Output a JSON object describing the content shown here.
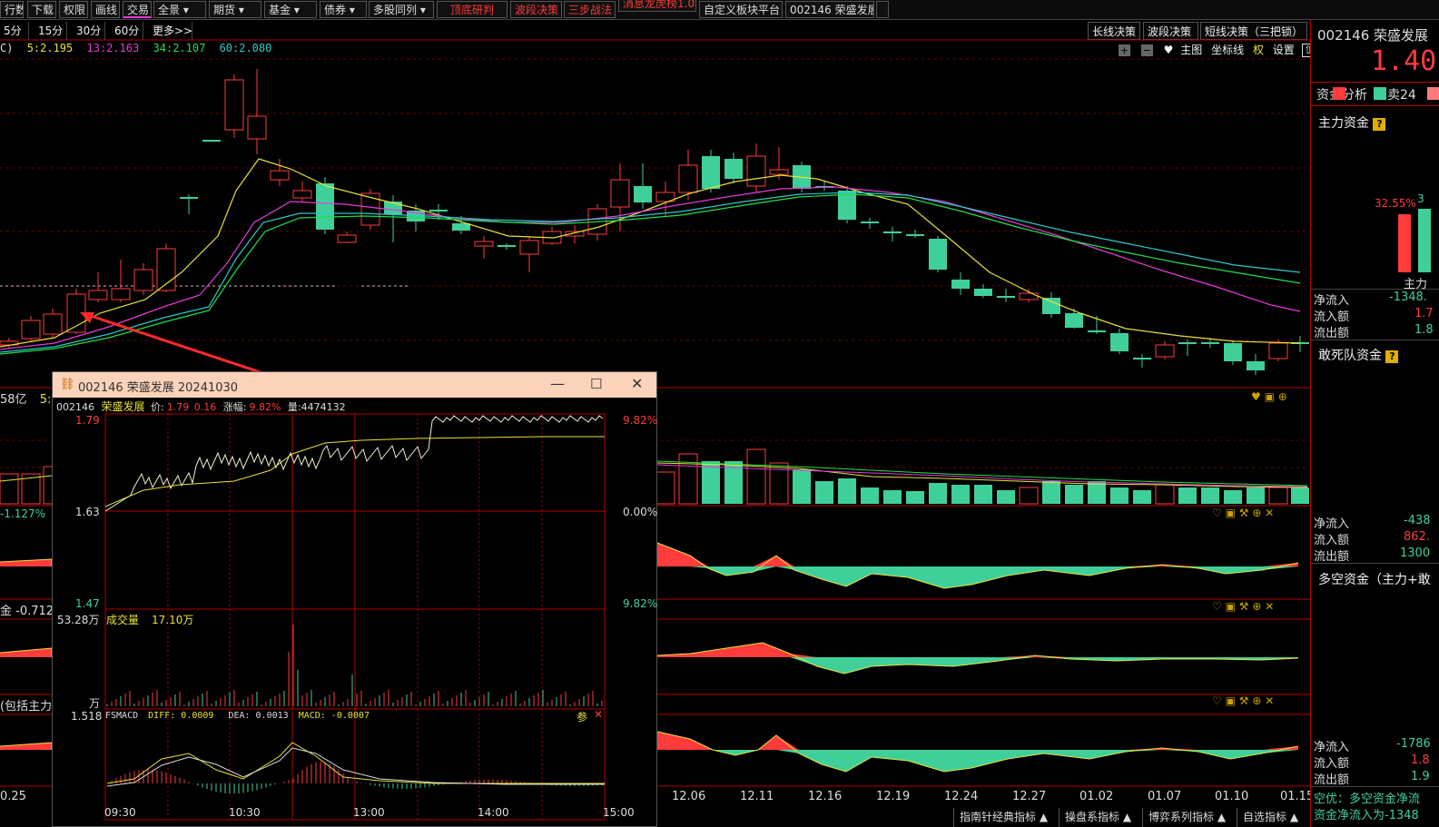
{
  "colors": {
    "up": "#ff3b3b",
    "down": "#3fd09a",
    "ma5": "#e8e13a",
    "ma13": "#e63ad8",
    "ma34": "#1fe04a",
    "ma60": "#2cc9c9",
    "panel_border": "#b00000"
  },
  "toolbar": {
    "items": [
      "行数",
      "下载",
      "权限",
      "画线",
      "交易",
      "",
      "全景 ▾",
      "期货 ▾",
      "基金 ▾",
      "债券 ▾",
      "多股同列 ▾",
      "顶底研判",
      "波段决策",
      "三步战法",
      "消息龙虎榜1.0",
      "自定义板块平台",
      "002146 荣盛发展"
    ]
  },
  "periods": [
    "5分",
    "15分",
    "30分",
    "60分",
    "更多>>"
  ],
  "decision_buttons": [
    "长线决策",
    "波段决策",
    "短线决策（三把锁）"
  ],
  "ma_legend": {
    "prefix": "C)",
    "ma5": "5:2.195",
    "ma13": "13:2.163",
    "ma34": "34:2.107",
    "ma60": "60:2.080"
  },
  "chart_tools": {
    "main": "主图",
    "axis": "坐标线",
    "rights": "权",
    "settings": "设置"
  },
  "left_labels": {
    "vol_prefix": "58亿",
    "vol_second": "5:",
    "pct": "-1.127%",
    "fund": "金 -0.712",
    "include_main": "(包括主力",
    "date_first": "0.25"
  },
  "x_dates": [
    "12.06",
    "12.11",
    "12.16",
    "12.19",
    "12.24",
    "12.27",
    "01.02",
    "01.07",
    "01.10",
    "01.15"
  ],
  "bottom_tabs": [
    "指南针经典指标 ▲",
    "操盘系指标 ▲",
    "博弈系列指标 ▲",
    "自选指标 ▲"
  ],
  "right_panel": {
    "code_name": "002146 荣盛发展",
    "price": "1.40",
    "tabs": {
      "analysis": "资金分析",
      "sell": "卖24"
    },
    "main_fund": "主力资金",
    "pct": "32.55%",
    "pct2": "3",
    "bar_label": "主力",
    "rows1": [
      {
        "k": "净流入",
        "v": "-1348."
      },
      {
        "k": "流入额",
        "v": "1.7"
      },
      {
        "k": "流出额",
        "v": "1.8"
      }
    ],
    "dare": "敢死队资金",
    "rows2": [
      {
        "k": "净流入",
        "v": "-438"
      },
      {
        "k": "流入额",
        "v": "862."
      },
      {
        "k": "流出额",
        "v": "1300"
      }
    ],
    "duokong": "多空资金（主力+敢",
    "rows3": [
      {
        "k": "净流入",
        "v": "-1786"
      },
      {
        "k": "流入额",
        "v": "1.8"
      },
      {
        "k": "流出额",
        "v": "1.9"
      }
    ],
    "footer1": "空优：多空资金净流",
    "footer2": "资金净流入为-1348"
  },
  "popup": {
    "title": "002146 荣盛发展 20241030",
    "code": "002146",
    "name": "荣盛发展",
    "price_label": "价:",
    "price": "1.79",
    "change": "0.16",
    "pct_label": "涨幅:",
    "pct": "9.82%",
    "vol_label": "量:",
    "vol": "4474132",
    "price_top": "1.79",
    "price_mid": "1.63",
    "price_low": "1.47",
    "pct_top": "9.82%",
    "pct_mid": "0.00%",
    "pct_low": "9.82%",
    "vol_max": "53.28万",
    "vol_title": "成交量",
    "vol_val": "17.10万",
    "vol_unit": "万",
    "macd_left": "1.518",
    "macd_name": "FSMACD",
    "diff": "DIFF: 0.0009",
    "dea": "DEA: 0.0013",
    "macd": "MACD: -0.0007",
    "param": "参",
    "times": [
      "09:30",
      "10:30",
      "13:00",
      "14:00",
      "15:00"
    ]
  }
}
